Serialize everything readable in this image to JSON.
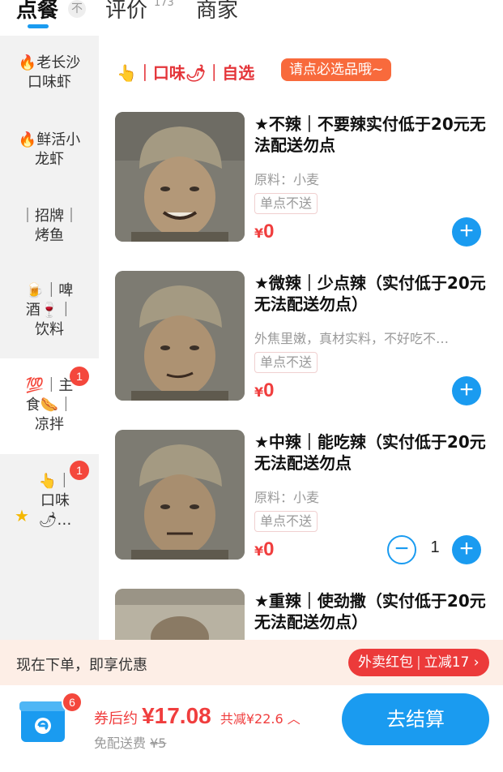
{
  "tabs": [
    {
      "label": "点餐"
    },
    {
      "label": "评价",
      "count": "173"
    },
    {
      "label": "商家"
    }
  ],
  "pin_label": "不",
  "sidebar": {
    "items": [
      {
        "label": "🔥老长沙口味虾"
      },
      {
        "label": "🔥鲜活小龙虾"
      },
      {
        "label": "｜招牌｜烤鱼"
      },
      {
        "label": "🍺｜啤酒🍷｜饮料"
      },
      {
        "label": "💯｜主食🌭｜凉拌",
        "badge": "1"
      },
      {
        "label": "👆｜口味🌶…",
        "badge": "1"
      }
    ]
  },
  "section": {
    "title": "👆｜口味🌶｜自选",
    "tag": "请点必选品哦~"
  },
  "items": [
    {
      "title": "★不辣｜不要辣实付低于20元无法配送勿点",
      "desc": "原料：小麦",
      "note": "单点不送",
      "currency": "¥",
      "price": "0"
    },
    {
      "title": "★微辣｜少点辣（实付低于20元无法配送勿点）",
      "desc": "外焦里嫩，真材实料，不好吃不…",
      "note": "单点不送",
      "currency": "¥",
      "price": "0"
    },
    {
      "title": "★中辣｜能吃辣（实付低于20元无法配送勿点",
      "desc": "原料：小麦",
      "note": "单点不送",
      "currency": "¥",
      "price": "0",
      "qty": "1"
    },
    {
      "title": "★重辣｜使劲撒（实付低于20元无法配送勿点）"
    }
  ],
  "promo": {
    "text": "现在下单，即享优惠",
    "btn_left": "外卖红包",
    "btn_right": "立减17",
    "chevron": "›"
  },
  "cart": {
    "badge": "6",
    "label": "券后约",
    "amount": "¥17.08",
    "saved": "共减¥22.6 ︿",
    "delivery": "免配送费",
    "delivery_old": "¥5",
    "checkout": "去结算"
  },
  "colors": {
    "accent": "#1a9bf0",
    "price": "#f03e3e",
    "promo_bg": "#fdeee6",
    "sidebar_bg": "#f2f2f2"
  },
  "icons": [
    "pin-icon",
    "star-icon",
    "add-icon",
    "minus-icon",
    "cart-box-icon"
  ]
}
